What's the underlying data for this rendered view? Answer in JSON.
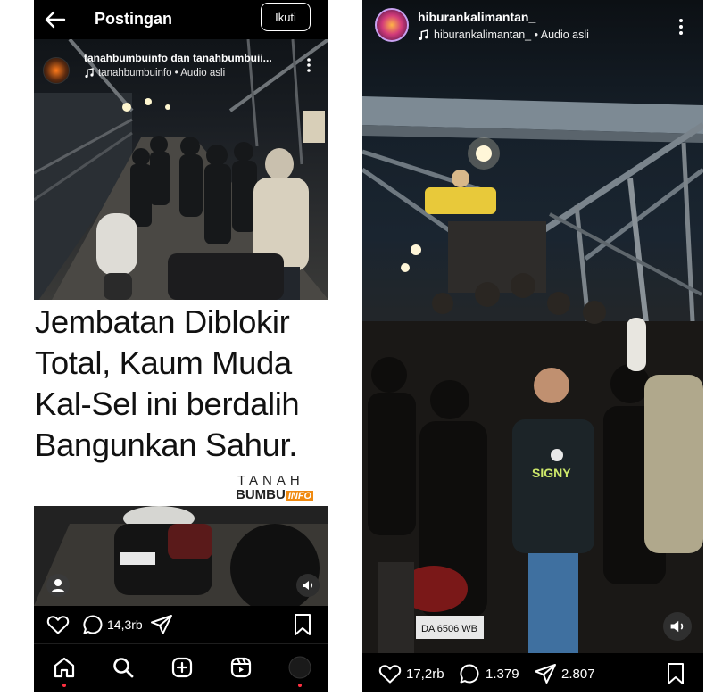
{
  "left_post": {
    "header": {
      "title": "Postingan",
      "follow_label": "Ikuti"
    },
    "author": {
      "usernames": "tanahbumbuinfo dan tanahbumbuii...",
      "audio": "tanahbumbuinfo • Audio asli"
    },
    "banner": {
      "headline_lines": [
        "Jembatan Diblokir",
        "Total, Kaum Muda",
        "Kal-Sel ini berdalih",
        "Bangunkan  Sahur."
      ],
      "brand_top": "TANAH",
      "brand_bottom": "BUMBU",
      "brand_badge": "INFO",
      "brand_color": "#f08a10"
    },
    "actions": {
      "comment_count": "14,3rb"
    },
    "bottom_nav": [
      "home-icon",
      "search-icon",
      "create-icon",
      "reels-icon",
      "profile-icon"
    ]
  },
  "right_post": {
    "author": {
      "username": "hiburankalimantan_",
      "audio": "hiburankalimantan_ • Audio asli"
    },
    "video_overlay": {
      "shirt_text": "SIGNY",
      "plate_text": "DA 6506 WB"
    },
    "actions": {
      "like_count": "17,2rb",
      "comment_count": "1.379",
      "share_count": "2.807"
    }
  },
  "colors": {
    "background": "#000000",
    "text": "#ffffff",
    "notification_dot": "#ff3040"
  }
}
